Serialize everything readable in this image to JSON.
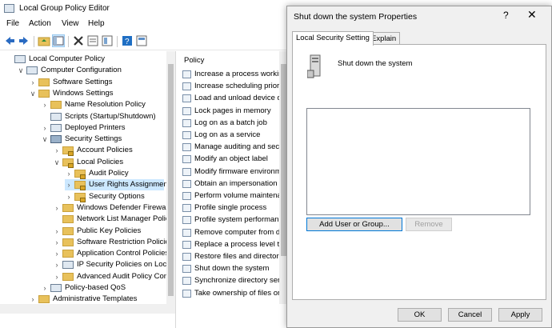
{
  "window": {
    "title": "Local Group Policy Editor"
  },
  "menu": [
    "File",
    "Action",
    "View",
    "Help"
  ],
  "tree": [
    {
      "label": "Local Computer Policy",
      "indent": 0,
      "icon": "computer-icon",
      "chev": ""
    },
    {
      "label": "Computer Configuration",
      "indent": 1,
      "icon": "computer-icon",
      "chev": "v"
    },
    {
      "label": "Software Settings",
      "indent": 2,
      "icon": "folder-icon",
      "chev": ">"
    },
    {
      "label": "Windows Settings",
      "indent": 2,
      "icon": "folder-icon",
      "chev": "v"
    },
    {
      "label": "Name Resolution Policy",
      "indent": 3,
      "icon": "folder-icon",
      "chev": ">"
    },
    {
      "label": "Scripts (Startup/Shutdown)",
      "indent": 3,
      "icon": "script-icon",
      "chev": ""
    },
    {
      "label": "Deployed Printers",
      "indent": 3,
      "icon": "printer-icon",
      "chev": ">"
    },
    {
      "label": "Security Settings",
      "indent": 3,
      "icon": "security-icon",
      "chev": "v"
    },
    {
      "label": "Account Policies",
      "indent": 4,
      "icon": "lock-folder-icon",
      "chev": ">"
    },
    {
      "label": "Local Policies",
      "indent": 4,
      "icon": "lock-folder-icon",
      "chev": "v"
    },
    {
      "label": "Audit Policy",
      "indent": 5,
      "icon": "lock-folder-icon",
      "chev": ">"
    },
    {
      "label": "User Rights Assignment",
      "indent": 5,
      "icon": "lock-folder-icon",
      "chev": ">",
      "selected": true
    },
    {
      "label": "Security Options",
      "indent": 5,
      "icon": "lock-folder-icon",
      "chev": ">"
    },
    {
      "label": "Windows Defender Firewall wi",
      "indent": 4,
      "icon": "folder-icon",
      "chev": ">"
    },
    {
      "label": "Network List Manager Policies",
      "indent": 4,
      "icon": "folder-icon",
      "chev": ""
    },
    {
      "label": "Public Key Policies",
      "indent": 4,
      "icon": "folder-icon",
      "chev": ">"
    },
    {
      "label": "Software Restriction Policies",
      "indent": 4,
      "icon": "folder-icon",
      "chev": ">"
    },
    {
      "label": "Application Control Policies",
      "indent": 4,
      "icon": "folder-icon",
      "chev": ">"
    },
    {
      "label": "IP Security Policies on Local C",
      "indent": 4,
      "icon": "ipsec-icon",
      "chev": ">"
    },
    {
      "label": "Advanced Audit Policy Config",
      "indent": 4,
      "icon": "folder-icon",
      "chev": ">"
    },
    {
      "label": "Policy-based QoS",
      "indent": 3,
      "icon": "qos-icon",
      "chev": ">"
    },
    {
      "label": "Administrative Templates",
      "indent": 2,
      "icon": "folder-icon",
      "chev": ">"
    }
  ],
  "list": {
    "header": "Policy",
    "items": [
      "Increase a process working s",
      "Increase scheduling priority",
      "Load and unload device drivers",
      "Lock pages in memory",
      "Log on as a batch job",
      "Log on as a service",
      "Manage auditing and security log",
      "Modify an object label",
      "Modify firmware environment values",
      "Obtain an impersonation token",
      "Perform volume maintenance tasks",
      "Profile single process",
      "Profile system performance",
      "Remove computer from docking station",
      "Replace a process level token",
      "Restore files and directories",
      "Shut down the system",
      "Synchronize directory service data",
      "Take ownership of files or other objects"
    ]
  },
  "dialog": {
    "title": "Shut down the system Properties",
    "help": "?",
    "close": "✕",
    "tabs": [
      "Local Security Setting",
      "Explain"
    ],
    "policy_name": "Shut down the system",
    "add_button": "Add User or Group...",
    "remove_button": "Remove",
    "ok": "OK",
    "cancel": "Cancel",
    "apply": "Apply"
  }
}
